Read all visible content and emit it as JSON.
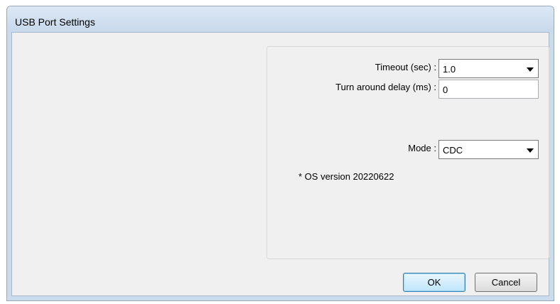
{
  "window": {
    "title": "USB Port Settings"
  },
  "settings": {
    "timeout_label": "Timeout (sec) :",
    "timeout_value": "1.0",
    "turnaround_label": "Turn around delay (ms) :",
    "turnaround_value": "0",
    "mode_label": "Mode :",
    "mode_value": "CDC",
    "note": "* OS version 20220622"
  },
  "buttons": {
    "ok": "OK",
    "cancel": "Cancel"
  },
  "icons": {
    "dropdown": "chevron-down-icon"
  }
}
